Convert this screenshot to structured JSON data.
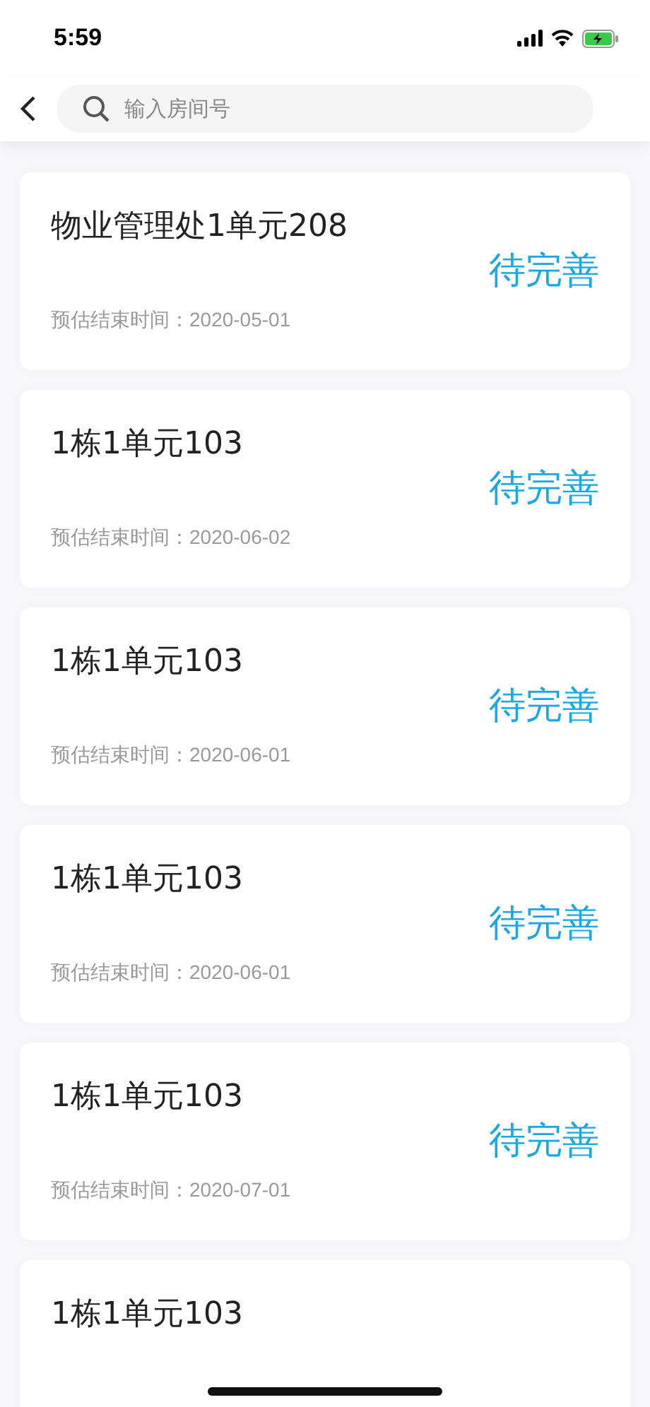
{
  "status_bar": {
    "time": "5:59"
  },
  "header": {
    "search": {
      "placeholder": "输入房间号"
    }
  },
  "rooms": [
    {
      "title": "物业管理处1单元208",
      "status": "待完善",
      "date_label": "预估结束时间：",
      "date": "2020-05-01"
    },
    {
      "title": "1栋1单元103",
      "status": "待完善",
      "date_label": "预估结束时间：",
      "date": "2020-06-02"
    },
    {
      "title": "1栋1单元103",
      "status": "待完善",
      "date_label": "预估结束时间：",
      "date": "2020-06-01"
    },
    {
      "title": "1栋1单元103",
      "status": "待完善",
      "date_label": "预估结束时间：",
      "date": "2020-06-01"
    },
    {
      "title": "1栋1单元103",
      "status": "待完善",
      "date_label": "预估结束时间：",
      "date": "2020-07-01"
    },
    {
      "title": "1栋1单元103"
    }
  ]
}
